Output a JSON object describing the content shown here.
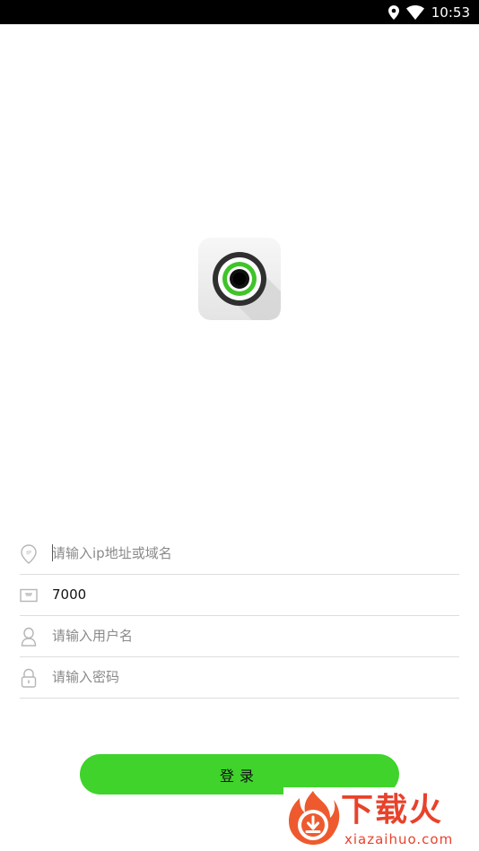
{
  "status_bar": {
    "time": "10:53",
    "icons": [
      "location-icon",
      "wifi-icon"
    ]
  },
  "form": {
    "host_field": {
      "value": "",
      "placeholder": "请输入ip地址或域名",
      "icon": "ip-location-icon"
    },
    "port_field": {
      "value": "7000",
      "placeholder": "",
      "icon": "port-icon"
    },
    "username_field": {
      "value": "",
      "placeholder": "请输入用户名",
      "icon": "user-icon"
    },
    "password_field": {
      "value": "",
      "placeholder": "请输入密码",
      "icon": "lock-icon"
    }
  },
  "login_button": {
    "label": "登录",
    "color": "#3fd32c"
  },
  "watermark": {
    "title": "下载火",
    "url": "xiazaihuo.com",
    "color": "#e8422b"
  },
  "colors": {
    "accent": "#3fd32c",
    "divider": "#dddddd",
    "placeholder": "#8a8a8a"
  }
}
